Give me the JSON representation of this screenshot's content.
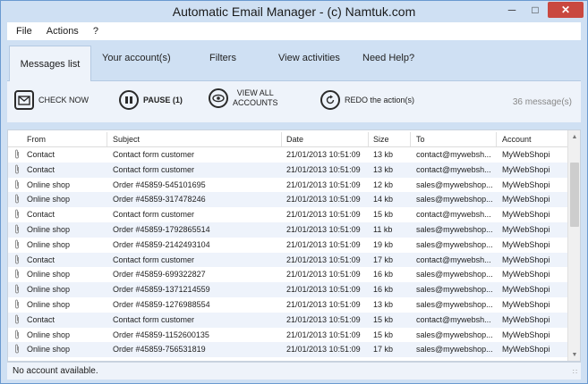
{
  "window": {
    "title": "Automatic Email Manager - (c) Namtuk.com"
  },
  "menu": {
    "items": [
      "File",
      "Actions",
      "?"
    ]
  },
  "tabs": [
    {
      "label": "Messages list",
      "active": true
    },
    {
      "label": "Your account(s)"
    },
    {
      "label": "Filters"
    },
    {
      "label": "View activities"
    },
    {
      "label": "Need Help?"
    }
  ],
  "toolbar": {
    "check_now": "CHECK NOW",
    "pause": "PAUSE (1)",
    "view_all_line1": "VIEW ALL",
    "view_all_line2": "ACCOUNTS",
    "redo": "REDO the action(s)",
    "message_count": "36 message(s)"
  },
  "table": {
    "columns": [
      "From",
      "Subject",
      "Date",
      "Size",
      "To",
      "Account"
    ],
    "rows": [
      [
        "Contact",
        "Contact form customer",
        "21/01/2013 10:51:09",
        "13 kb",
        "contact@mywebsh...",
        "MyWebShopi"
      ],
      [
        "Contact",
        "Contact form customer",
        "21/01/2013 10:51:09",
        "13 kb",
        "contact@mywebsh...",
        "MyWebShopi"
      ],
      [
        "Online shop",
        "Order #45859-545101695",
        "21/01/2013 10:51:09",
        "12 kb",
        "sales@mywebshop...",
        "MyWebShopi"
      ],
      [
        "Online shop",
        "Order #45859-317478246",
        "21/01/2013 10:51:09",
        "14 kb",
        "sales@mywebshop...",
        "MyWebShopi"
      ],
      [
        "Contact",
        "Contact form customer",
        "21/01/2013 10:51:09",
        "15 kb",
        "contact@mywebsh...",
        "MyWebShopi"
      ],
      [
        "Online shop",
        "Order #45859-1792865514",
        "21/01/2013 10:51:09",
        "11 kb",
        "sales@mywebshop...",
        "MyWebShopi"
      ],
      [
        "Online shop",
        "Order #45859-2142493104",
        "21/01/2013 10:51:09",
        "19 kb",
        "sales@mywebshop...",
        "MyWebShopi"
      ],
      [
        "Contact",
        "Contact form customer",
        "21/01/2013 10:51:09",
        "17 kb",
        "contact@mywebsh...",
        "MyWebShopi"
      ],
      [
        "Online shop",
        "Order #45859-699322827",
        "21/01/2013 10:51:09",
        "16 kb",
        "sales@mywebshop...",
        "MyWebShopi"
      ],
      [
        "Online shop",
        "Order #45859-1371214559",
        "21/01/2013 10:51:09",
        "16 kb",
        "sales@mywebshop...",
        "MyWebShopi"
      ],
      [
        "Online shop",
        "Order #45859-1276988554",
        "21/01/2013 10:51:09",
        "13 kb",
        "sales@mywebshop...",
        "MyWebShopi"
      ],
      [
        "Contact",
        "Contact form customer",
        "21/01/2013 10:51:09",
        "15 kb",
        "contact@mywebsh...",
        "MyWebShopi"
      ],
      [
        "Online shop",
        "Order #45859-1152600135",
        "21/01/2013 10:51:09",
        "15 kb",
        "sales@mywebshop...",
        "MyWebShopi"
      ],
      [
        "Online shop",
        "Order #45859-756531819",
        "21/01/2013 10:51:09",
        "17 kb",
        "sales@mywebshop...",
        "MyWebShopi"
      ]
    ]
  },
  "status": {
    "text": "No account available."
  },
  "colors": {
    "chrome": "#cfe0f3",
    "panel": "#eef3fa",
    "close": "#c9483f",
    "row_alt": "#eef3fb"
  },
  "icons": {
    "check_now": "envelope-check-icon",
    "pause": "pause-icon",
    "view_all": "eye-icon",
    "redo": "redo-icon",
    "attachment": "paperclip-icon"
  }
}
